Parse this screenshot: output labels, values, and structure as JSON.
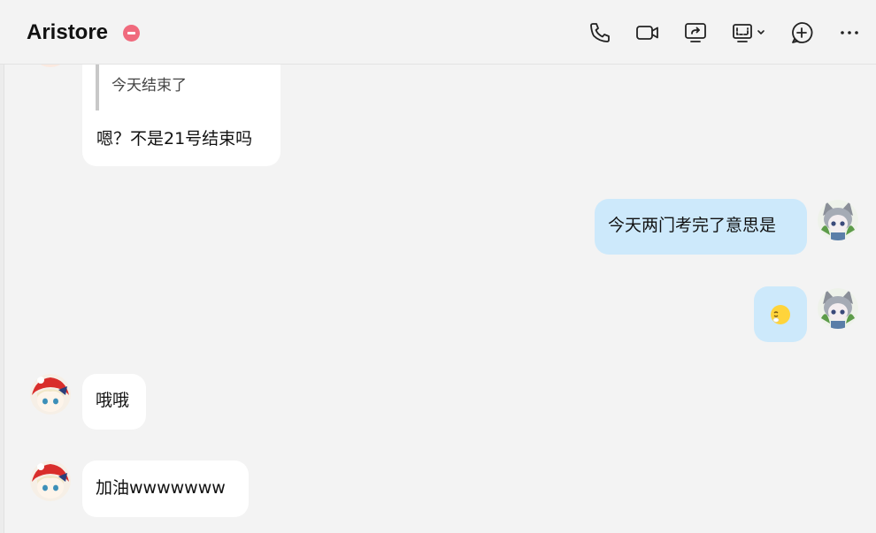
{
  "header": {
    "title": "Aristore",
    "status": "do-not-disturb"
  },
  "toolbar": {
    "icons": [
      "phone-icon",
      "video-camera-icon",
      "share-screen-icon",
      "screen-layout-icon",
      "add-people-icon",
      "more-icon"
    ]
  },
  "messages": {
    "m1": {
      "quoted_text": "今天结束了",
      "text": "嗯？不是21号结束吗"
    },
    "m2": {
      "text": "今天两门考完了意思是"
    },
    "m3": {
      "emoji": "sleepy-face-emoji"
    },
    "m4": {
      "text": "哦哦"
    },
    "m5": {
      "text": "加油wwwwwww"
    }
  },
  "colors": {
    "background": "#f3f3f3",
    "incoming_bubble": "#ffffff",
    "outgoing_bubble": "#cde9fb",
    "status_dnd": "#f06a7d"
  }
}
